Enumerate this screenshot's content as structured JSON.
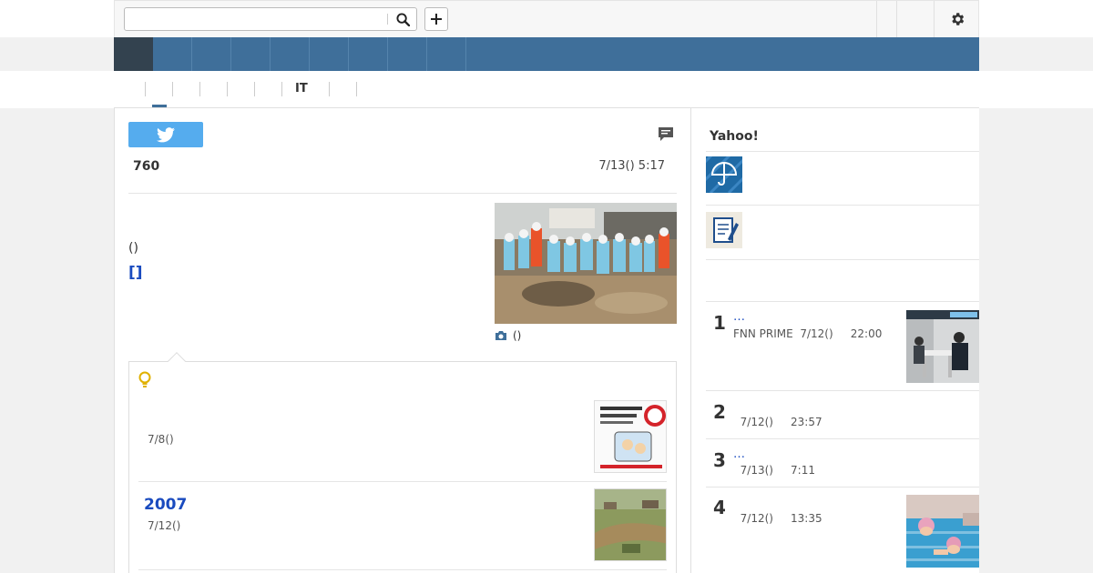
{
  "search": {
    "placeholder": "",
    "value": ""
  },
  "subnav": {
    "tabs": [
      "",
      "",
      "",
      "",
      "",
      "IT",
      "",
      ""
    ]
  },
  "article": {
    "count": "760",
    "date": "7/13() 5:17",
    "paren_text": "()",
    "bracket_link": "[]",
    "photo_caption": "()"
  },
  "related": {
    "items": [
      {
        "title": "",
        "date": "7/8()"
      },
      {
        "title": "2007",
        "date": "7/12()"
      }
    ]
  },
  "sidebar": {
    "title": "Yahoo!",
    "ranking": [
      {
        "num": "1",
        "title": "…",
        "source": "FNN PRIME",
        "date": "7/12()",
        "time": "22:00"
      },
      {
        "num": "2",
        "title": "",
        "source": "",
        "date": "7/12()",
        "time": "23:57"
      },
      {
        "num": "3",
        "title": "…",
        "source": "",
        "date": "7/13()",
        "time": "7:11"
      },
      {
        "num": "4",
        "title": "",
        "source": "",
        "date": "7/12()",
        "time": "13:35"
      }
    ]
  },
  "colors": {
    "nav_blue": "#3f6f9a",
    "nav_dark": "#33424f",
    "link_blue": "#1a4bbf",
    "twitter_blue": "#55acee"
  }
}
